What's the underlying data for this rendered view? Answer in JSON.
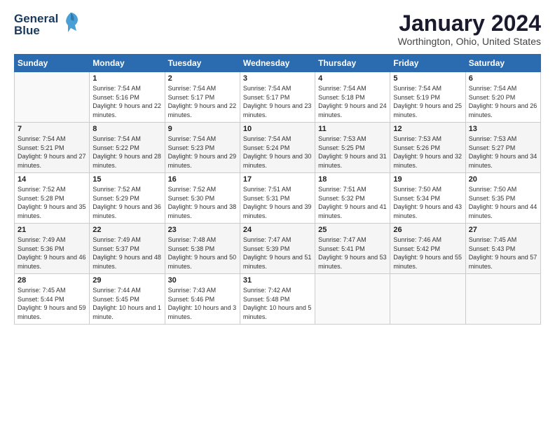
{
  "header": {
    "logo_line1": "General",
    "logo_line2": "Blue",
    "month": "January 2024",
    "location": "Worthington, Ohio, United States"
  },
  "days_of_week": [
    "Sunday",
    "Monday",
    "Tuesday",
    "Wednesday",
    "Thursday",
    "Friday",
    "Saturday"
  ],
  "weeks": [
    [
      {
        "num": "",
        "sunrise": "",
        "sunset": "",
        "daylight": ""
      },
      {
        "num": "1",
        "sunrise": "Sunrise: 7:54 AM",
        "sunset": "Sunset: 5:16 PM",
        "daylight": "Daylight: 9 hours and 22 minutes."
      },
      {
        "num": "2",
        "sunrise": "Sunrise: 7:54 AM",
        "sunset": "Sunset: 5:17 PM",
        "daylight": "Daylight: 9 hours and 22 minutes."
      },
      {
        "num": "3",
        "sunrise": "Sunrise: 7:54 AM",
        "sunset": "Sunset: 5:17 PM",
        "daylight": "Daylight: 9 hours and 23 minutes."
      },
      {
        "num": "4",
        "sunrise": "Sunrise: 7:54 AM",
        "sunset": "Sunset: 5:18 PM",
        "daylight": "Daylight: 9 hours and 24 minutes."
      },
      {
        "num": "5",
        "sunrise": "Sunrise: 7:54 AM",
        "sunset": "Sunset: 5:19 PM",
        "daylight": "Daylight: 9 hours and 25 minutes."
      },
      {
        "num": "6",
        "sunrise": "Sunrise: 7:54 AM",
        "sunset": "Sunset: 5:20 PM",
        "daylight": "Daylight: 9 hours and 26 minutes."
      }
    ],
    [
      {
        "num": "7",
        "sunrise": "Sunrise: 7:54 AM",
        "sunset": "Sunset: 5:21 PM",
        "daylight": "Daylight: 9 hours and 27 minutes."
      },
      {
        "num": "8",
        "sunrise": "Sunrise: 7:54 AM",
        "sunset": "Sunset: 5:22 PM",
        "daylight": "Daylight: 9 hours and 28 minutes."
      },
      {
        "num": "9",
        "sunrise": "Sunrise: 7:54 AM",
        "sunset": "Sunset: 5:23 PM",
        "daylight": "Daylight: 9 hours and 29 minutes."
      },
      {
        "num": "10",
        "sunrise": "Sunrise: 7:54 AM",
        "sunset": "Sunset: 5:24 PM",
        "daylight": "Daylight: 9 hours and 30 minutes."
      },
      {
        "num": "11",
        "sunrise": "Sunrise: 7:53 AM",
        "sunset": "Sunset: 5:25 PM",
        "daylight": "Daylight: 9 hours and 31 minutes."
      },
      {
        "num": "12",
        "sunrise": "Sunrise: 7:53 AM",
        "sunset": "Sunset: 5:26 PM",
        "daylight": "Daylight: 9 hours and 32 minutes."
      },
      {
        "num": "13",
        "sunrise": "Sunrise: 7:53 AM",
        "sunset": "Sunset: 5:27 PM",
        "daylight": "Daylight: 9 hours and 34 minutes."
      }
    ],
    [
      {
        "num": "14",
        "sunrise": "Sunrise: 7:52 AM",
        "sunset": "Sunset: 5:28 PM",
        "daylight": "Daylight: 9 hours and 35 minutes."
      },
      {
        "num": "15",
        "sunrise": "Sunrise: 7:52 AM",
        "sunset": "Sunset: 5:29 PM",
        "daylight": "Daylight: 9 hours and 36 minutes."
      },
      {
        "num": "16",
        "sunrise": "Sunrise: 7:52 AM",
        "sunset": "Sunset: 5:30 PM",
        "daylight": "Daylight: 9 hours and 38 minutes."
      },
      {
        "num": "17",
        "sunrise": "Sunrise: 7:51 AM",
        "sunset": "Sunset: 5:31 PM",
        "daylight": "Daylight: 9 hours and 39 minutes."
      },
      {
        "num": "18",
        "sunrise": "Sunrise: 7:51 AM",
        "sunset": "Sunset: 5:32 PM",
        "daylight": "Daylight: 9 hours and 41 minutes."
      },
      {
        "num": "19",
        "sunrise": "Sunrise: 7:50 AM",
        "sunset": "Sunset: 5:34 PM",
        "daylight": "Daylight: 9 hours and 43 minutes."
      },
      {
        "num": "20",
        "sunrise": "Sunrise: 7:50 AM",
        "sunset": "Sunset: 5:35 PM",
        "daylight": "Daylight: 9 hours and 44 minutes."
      }
    ],
    [
      {
        "num": "21",
        "sunrise": "Sunrise: 7:49 AM",
        "sunset": "Sunset: 5:36 PM",
        "daylight": "Daylight: 9 hours and 46 minutes."
      },
      {
        "num": "22",
        "sunrise": "Sunrise: 7:49 AM",
        "sunset": "Sunset: 5:37 PM",
        "daylight": "Daylight: 9 hours and 48 minutes."
      },
      {
        "num": "23",
        "sunrise": "Sunrise: 7:48 AM",
        "sunset": "Sunset: 5:38 PM",
        "daylight": "Daylight: 9 hours and 50 minutes."
      },
      {
        "num": "24",
        "sunrise": "Sunrise: 7:47 AM",
        "sunset": "Sunset: 5:39 PM",
        "daylight": "Daylight: 9 hours and 51 minutes."
      },
      {
        "num": "25",
        "sunrise": "Sunrise: 7:47 AM",
        "sunset": "Sunset: 5:41 PM",
        "daylight": "Daylight: 9 hours and 53 minutes."
      },
      {
        "num": "26",
        "sunrise": "Sunrise: 7:46 AM",
        "sunset": "Sunset: 5:42 PM",
        "daylight": "Daylight: 9 hours and 55 minutes."
      },
      {
        "num": "27",
        "sunrise": "Sunrise: 7:45 AM",
        "sunset": "Sunset: 5:43 PM",
        "daylight": "Daylight: 9 hours and 57 minutes."
      }
    ],
    [
      {
        "num": "28",
        "sunrise": "Sunrise: 7:45 AM",
        "sunset": "Sunset: 5:44 PM",
        "daylight": "Daylight: 9 hours and 59 minutes."
      },
      {
        "num": "29",
        "sunrise": "Sunrise: 7:44 AM",
        "sunset": "Sunset: 5:45 PM",
        "daylight": "Daylight: 10 hours and 1 minute."
      },
      {
        "num": "30",
        "sunrise": "Sunrise: 7:43 AM",
        "sunset": "Sunset: 5:46 PM",
        "daylight": "Daylight: 10 hours and 3 minutes."
      },
      {
        "num": "31",
        "sunrise": "Sunrise: 7:42 AM",
        "sunset": "Sunset: 5:48 PM",
        "daylight": "Daylight: 10 hours and 5 minutes."
      },
      {
        "num": "",
        "sunrise": "",
        "sunset": "",
        "daylight": ""
      },
      {
        "num": "",
        "sunrise": "",
        "sunset": "",
        "daylight": ""
      },
      {
        "num": "",
        "sunrise": "",
        "sunset": "",
        "daylight": ""
      }
    ]
  ]
}
